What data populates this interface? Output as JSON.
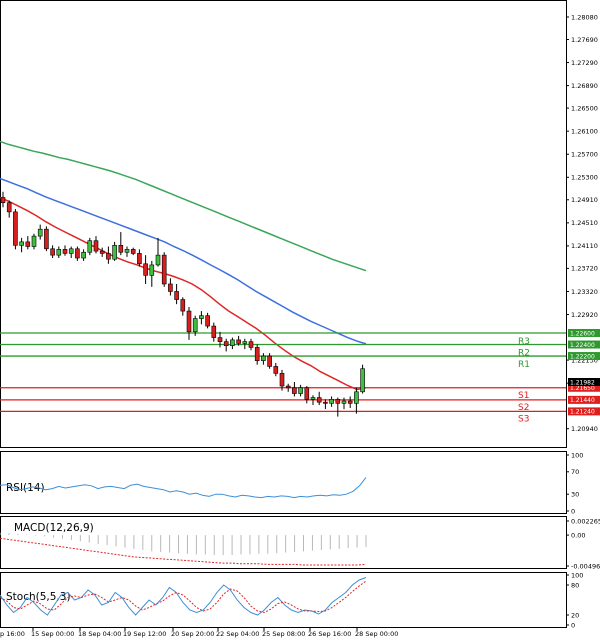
{
  "chart_data": {
    "type": "candlestick",
    "price_ticks": [
      "1.28080",
      "1.27690",
      "1.27290",
      "1.26890",
      "1.26500",
      "1.26100",
      "1.25700",
      "1.25300",
      "1.24910",
      "1.24510",
      "1.24110",
      "1.23720",
      "1.23320",
      "1.22920",
      "1.22130",
      "1.21730",
      "1.20940"
    ],
    "time_ticks": [
      "15 Sep 00:00",
      "18 Sep 04:00",
      "19 Sep 12:00",
      "20 Sep 20:00",
      "22 Sep 04:00",
      "25 Sep 08:00",
      "26 Sep 16:00",
      "28 Sep 00:00"
    ],
    "first_tick_partial": "p 16:00",
    "ylim": [
      1.2064,
      1.2834
    ],
    "current_price": "1.21982",
    "levels": [
      {
        "name": "R3",
        "price": 1.226,
        "label": "1.22600",
        "color": "#2e9a2e"
      },
      {
        "name": "R2",
        "price": 1.224,
        "label": "1.22400",
        "color": "#2e9a2e"
      },
      {
        "name": "R1",
        "price": 1.222,
        "label": "1.22200",
        "color": "#2e9a2e"
      },
      {
        "name": "S1",
        "price": 1.2165,
        "label": "1.21650",
        "color": "#e01e1e"
      },
      {
        "name": "S2",
        "price": 1.2144,
        "label": "1.21440",
        "color": "#e01e1e"
      },
      {
        "name": "S3",
        "price": 1.2124,
        "label": "1.21240",
        "color": "#e01e1e"
      }
    ],
    "candles": [
      [
        1.2495,
        1.2505,
        1.2478,
        1.2486
      ],
      [
        1.2486,
        1.249,
        1.246,
        1.247
      ],
      [
        1.247,
        1.2475,
        1.2405,
        1.2412
      ],
      [
        1.2412,
        1.2425,
        1.24,
        1.2418
      ],
      [
        1.2418,
        1.2428,
        1.2405,
        1.241
      ],
      [
        1.241,
        1.2432,
        1.2405,
        1.2428
      ],
      [
        1.2428,
        1.2448,
        1.2422,
        1.244
      ],
      [
        1.244,
        1.2445,
        1.2402,
        1.2406
      ],
      [
        1.2406,
        1.2412,
        1.239,
        1.2395
      ],
      [
        1.2395,
        1.241,
        1.239,
        1.2405
      ],
      [
        1.2405,
        1.2412,
        1.2394,
        1.2398
      ],
      [
        1.2398,
        1.241,
        1.239,
        1.2406
      ],
      [
        1.2406,
        1.241,
        1.2385,
        1.239
      ],
      [
        1.239,
        1.2405,
        1.2385,
        1.24
      ],
      [
        1.24,
        1.2425,
        1.2395,
        1.242
      ],
      [
        1.242,
        1.2428,
        1.2398,
        1.2402
      ],
      [
        1.2402,
        1.2408,
        1.2392,
        1.2398
      ],
      [
        1.2398,
        1.241,
        1.238,
        1.2388
      ],
      [
        1.2388,
        1.2418,
        1.2385,
        1.2412
      ],
      [
        1.2412,
        1.2435,
        1.2395,
        1.24
      ],
      [
        1.24,
        1.241,
        1.2392,
        1.2405
      ],
      [
        1.2405,
        1.2408,
        1.2395,
        1.2398
      ],
      [
        1.2398,
        1.2405,
        1.2375,
        1.238
      ],
      [
        1.238,
        1.2395,
        1.2345,
        1.236
      ],
      [
        1.236,
        1.2385,
        1.234,
        1.2378
      ],
      [
        1.2378,
        1.2425,
        1.2375,
        1.2395
      ],
      [
        1.2395,
        1.24,
        1.234,
        1.2345
      ],
      [
        1.2345,
        1.2355,
        1.2325,
        1.2332
      ],
      [
        1.2332,
        1.2345,
        1.231,
        1.2318
      ],
      [
        1.2318,
        1.2322,
        1.229,
        1.2298
      ],
      [
        1.2298,
        1.2305,
        1.2248,
        1.2262
      ],
      [
        1.2262,
        1.229,
        1.2255,
        1.2285
      ],
      [
        1.2285,
        1.2298,
        1.2275,
        1.229
      ],
      [
        1.229,
        1.2295,
        1.2268,
        1.2272
      ],
      [
        1.2272,
        1.2278,
        1.2245,
        1.2252
      ],
      [
        1.2252,
        1.2262,
        1.2235,
        1.2245
      ],
      [
        1.2245,
        1.225,
        1.2228,
        1.2238
      ],
      [
        1.2238,
        1.2252,
        1.2232,
        1.2248
      ],
      [
        1.2248,
        1.2255,
        1.2238,
        1.2242
      ],
      [
        1.2242,
        1.225,
        1.2232,
        1.2245
      ],
      [
        1.2245,
        1.225,
        1.223,
        1.2235
      ],
      [
        1.2235,
        1.224,
        1.2205,
        1.2212
      ],
      [
        1.2212,
        1.2225,
        1.2205,
        1.222
      ],
      [
        1.222,
        1.2225,
        1.2198,
        1.2202
      ],
      [
        1.2202,
        1.2208,
        1.2185,
        1.219
      ],
      [
        1.219,
        1.2196,
        1.216,
        1.2168
      ],
      [
        1.2168,
        1.2172,
        1.2158,
        1.2165
      ],
      [
        1.2165,
        1.2175,
        1.215,
        1.2155
      ],
      [
        1.2155,
        1.217,
        1.215,
        1.2165
      ],
      [
        1.2165,
        1.2168,
        1.2138,
        1.2145
      ],
      [
        1.2145,
        1.2152,
        1.2135,
        1.2148
      ],
      [
        1.2148,
        1.2158,
        1.2135,
        1.214
      ],
      [
        1.214,
        1.2145,
        1.2128,
        1.2138
      ],
      [
        1.2138,
        1.215,
        1.2132,
        1.2145
      ],
      [
        1.2145,
        1.2148,
        1.2115,
        1.2138
      ],
      [
        1.2138,
        1.2148,
        1.2128,
        1.2142
      ],
      [
        1.2142,
        1.215,
        1.213,
        1.2138
      ],
      [
        1.2138,
        1.2165,
        1.212,
        1.2158
      ],
      [
        1.2158,
        1.2205,
        1.2155,
        1.2198
      ]
    ],
    "ma_fast": [
      1.2495,
      1.2488,
      1.248,
      1.2472,
      1.2463,
      1.2453,
      1.2444,
      1.2436,
      1.2428,
      1.242,
      1.2412,
      1.2404,
      1.2396,
      1.2389,
      1.2383,
      1.2378,
      1.2372,
      1.2367,
      1.2363,
      1.2358,
      1.2352,
      1.2345,
      1.2335,
      1.2323,
      1.231,
      1.2298,
      1.2288,
      1.2278,
      1.2268,
      1.2256,
      1.2243,
      1.2231,
      1.222,
      1.2211,
      1.2203,
      1.2193,
      1.2185,
      1.2177,
      1.2169,
      1.2162,
      1.2165
    ],
    "ma_mid": [
      1.2528,
      1.2522,
      1.2516,
      1.251,
      1.2503,
      1.2496,
      1.249,
      1.2484,
      1.2478,
      1.2472,
      1.2466,
      1.246,
      1.2454,
      1.2448,
      1.2442,
      1.2436,
      1.243,
      1.2424,
      1.2418,
      1.241,
      1.2403,
      1.2395,
      1.2387,
      1.2378,
      1.237,
      1.2361,
      1.2352,
      1.2342,
      1.2332,
      1.2323,
      1.2314,
      1.2305,
      1.2296,
      1.2288,
      1.228,
      1.2273,
      1.2266,
      1.2259,
      1.2252,
      1.2246,
      1.2241
    ],
    "ma_slow": [
      1.2592,
      1.2587,
      1.2583,
      1.2579,
      1.2575,
      1.2572,
      1.2568,
      1.2564,
      1.2561,
      1.2557,
      1.2553,
      1.2549,
      1.2545,
      1.2541,
      1.2536,
      1.2531,
      1.2526,
      1.252,
      1.2514,
      1.2508,
      1.2502,
      1.2496,
      1.249,
      1.2484,
      1.2478,
      1.2472,
      1.2466,
      1.246,
      1.2454,
      1.2448,
      1.2442,
      1.2436,
      1.243,
      1.2424,
      1.2418,
      1.2412,
      1.2406,
      1.24,
      1.2394,
      1.2388,
      1.2383,
      1.2378,
      1.2373,
      1.2368
    ],
    "rsi": {
      "label": "RSI(14)",
      "ticks": [
        "100",
        "70",
        "30",
        "0"
      ],
      "ylim": [
        0,
        100
      ],
      "values": [
        46,
        47,
        42,
        38,
        40,
        43,
        41,
        38,
        40,
        44,
        41,
        43,
        45,
        47,
        45,
        40,
        43,
        44,
        42,
        40,
        46,
        48,
        44,
        42,
        40,
        38,
        34,
        36,
        34,
        30,
        32,
        28,
        26,
        30,
        30,
        27,
        25,
        28,
        27,
        25,
        24,
        26,
        25,
        27,
        26,
        24,
        26,
        25,
        27,
        28,
        27,
        29,
        28,
        30,
        35,
        45,
        60
      ]
    },
    "macd": {
      "label": "MACD(12,26,9)",
      "ticks": [
        "0.002265",
        "0.00",
        "-0.004961"
      ],
      "ylim": [
        -0.004961,
        0.002265
      ],
      "hist": [
        0.0004,
        0.0003,
        0.0002,
        0.0001,
        -0.0001,
        -0.0002,
        -0.0004,
        -0.0006,
        -0.0008,
        -0.001,
        -0.0012,
        -0.0014,
        -0.0016,
        -0.0018,
        -0.002,
        -0.0022,
        -0.0024,
        -0.0026,
        -0.0027,
        -0.0028,
        -0.0029,
        -0.003,
        -0.0031,
        -0.0031,
        -0.0032,
        -0.0032,
        -0.0032,
        -0.0031,
        -0.0031,
        -0.003,
        -0.003,
        -0.0029,
        -0.0028,
        -0.0027,
        -0.0026,
        -0.0025,
        -0.0024,
        -0.0023,
        -0.0022,
        -0.0021,
        -0.002,
        -0.0019
      ],
      "signal": [
        -0.0005,
        -0.0007,
        -0.0009,
        -0.0011,
        -0.0013,
        -0.0015,
        -0.0017,
        -0.0019,
        -0.0021,
        -0.0023,
        -0.0025,
        -0.0027,
        -0.0029,
        -0.0031,
        -0.0033,
        -0.0035,
        -0.0036,
        -0.0037,
        -0.0038,
        -0.0039,
        -0.004,
        -0.0041,
        -0.0042,
        -0.0043,
        -0.0044,
        -0.0045,
        -0.0045,
        -0.0046,
        -0.0046,
        -0.0046,
        -0.0047,
        -0.0047,
        -0.0047,
        -0.0047,
        -0.0048,
        -0.0048,
        -0.0048,
        -0.0048,
        -0.0048,
        -0.0048,
        -0.0048,
        -0.0047
      ]
    },
    "stoch": {
      "label": "Stoch(5,5,3)",
      "ticks": [
        "100",
        "80",
        "20",
        "0"
      ],
      "ylim": [
        0,
        100
      ],
      "k": [
        60,
        40,
        25,
        35,
        55,
        45,
        30,
        20,
        40,
        60,
        65,
        50,
        55,
        70,
        60,
        40,
        45,
        65,
        55,
        35,
        20,
        35,
        50,
        40,
        55,
        75,
        65,
        45,
        30,
        25,
        30,
        45,
        65,
        80,
        70,
        50,
        35,
        25,
        20,
        30,
        45,
        55,
        40,
        30,
        25,
        30,
        28,
        22,
        30,
        45,
        55,
        65,
        80,
        90,
        95
      ],
      "d": [
        55,
        48,
        35,
        32,
        40,
        48,
        42,
        32,
        30,
        42,
        55,
        58,
        55,
        60,
        62,
        55,
        46,
        50,
        55,
        50,
        38,
        30,
        35,
        42,
        48,
        58,
        65,
        60,
        48,
        35,
        28,
        32,
        45,
        62,
        72,
        68,
        55,
        38,
        28,
        25,
        32,
        43,
        46,
        40,
        32,
        28,
        28,
        27,
        28,
        35,
        45,
        55,
        67,
        78,
        88
      ]
    }
  }
}
